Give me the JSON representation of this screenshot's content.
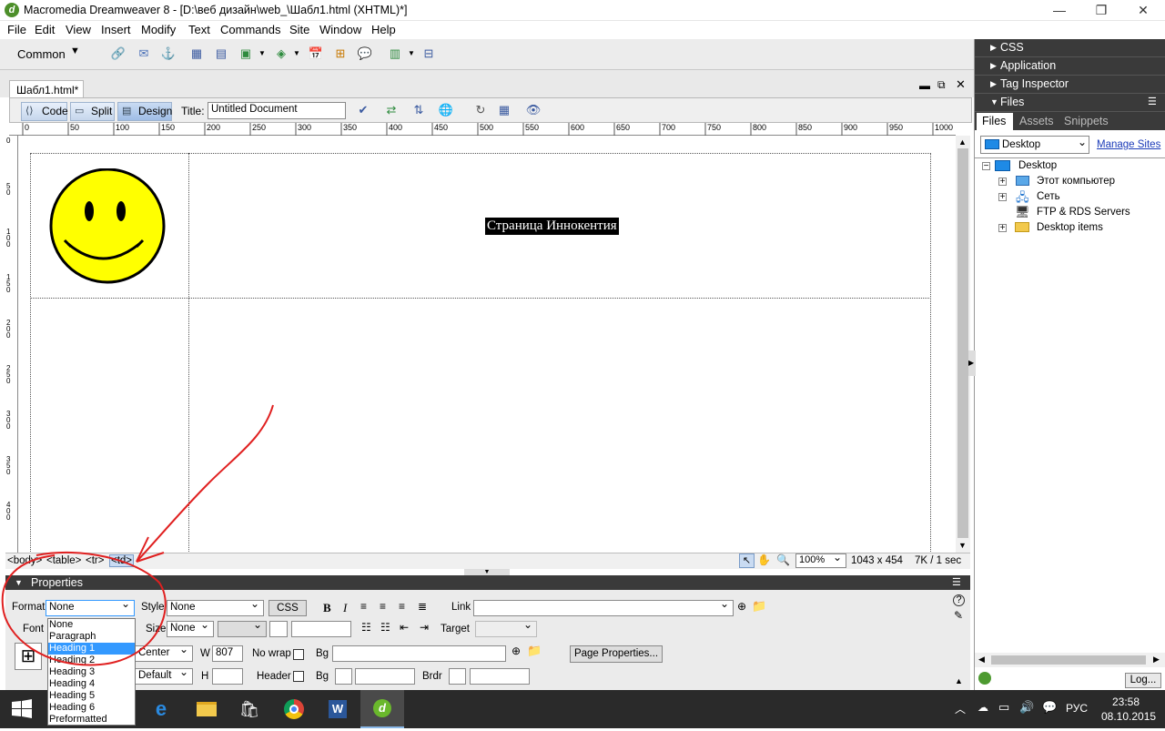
{
  "window": {
    "title": "Macromedia Dreamweaver 8 - [D:\\веб дизайн\\web_\\Шабл1.html (XHTML)*]"
  },
  "menu": [
    "File",
    "Edit",
    "View",
    "Insert",
    "Modify",
    "Text",
    "Commands",
    "Site",
    "Window",
    "Help"
  ],
  "insertbar": {
    "category": "Common"
  },
  "document": {
    "tab": "Шабл1.html*",
    "views": {
      "code": "Code",
      "split": "Split",
      "design": "Design"
    },
    "title_label": "Title:",
    "title_value": "Untitled Document",
    "ruler_h": [
      "0",
      "50",
      "100",
      "150",
      "200",
      "250",
      "300",
      "350",
      "400",
      "450",
      "500",
      "550",
      "600",
      "650",
      "700",
      "750",
      "800",
      "850",
      "900",
      "950",
      "1000"
    ],
    "ruler_v": [
      "0",
      "5 0",
      "1 0 0",
      "1 5 0",
      "2 0 0",
      "2 5 0",
      "3 0 0",
      "3 5 0",
      "4 0 0"
    ],
    "heading_text": "Страница Иннокентия"
  },
  "status": {
    "tags": [
      "<body>",
      "<table>",
      "<tr>",
      "<td>"
    ],
    "zoom": "100%",
    "size": "1043 x 454",
    "download": "7K / 1 sec"
  },
  "properties": {
    "header": "Properties",
    "format_label": "Format",
    "format_value": "None",
    "style_label": "Style",
    "style_value": "None",
    "css_button": "CSS",
    "link_label": "Link",
    "font_label": "Font",
    "size_label": "Size",
    "size_value": "None",
    "target_label": "Target",
    "horz_value": "Center",
    "w_label": "W",
    "w_value": "807",
    "nowrap_label": "No wrap",
    "bg_label": "Bg",
    "page_properties": "Page Properties...",
    "vert_value": "Default",
    "h_label": "H",
    "header_label": "Header",
    "bg2_label": "Bg",
    "brdr_label": "Brdr",
    "format_options": [
      "None",
      "Paragraph",
      "Heading 1",
      "Heading 2",
      "Heading 3",
      "Heading 4",
      "Heading 5",
      "Heading 6",
      "Preformatted"
    ],
    "format_highlighted": "Heading 1"
  },
  "right_panel": {
    "groups": [
      "CSS",
      "Application",
      "Tag Inspector",
      "Files"
    ],
    "tabs": [
      "Files",
      "Assets",
      "Snippets"
    ],
    "site_select": "Desktop",
    "manage_sites": "Manage Sites",
    "tree": [
      "Desktop",
      "Этот компьютер",
      "Сеть",
      "FTP & RDS Servers",
      "Desktop items"
    ],
    "log_button": "Log..."
  },
  "taskbar": {
    "lang": "РУС",
    "time": "23:58",
    "date": "08.10.2015"
  },
  "colors": {
    "smiley": "#ffff00",
    "annotation": "#e02020",
    "highlight": "#3399ff"
  }
}
